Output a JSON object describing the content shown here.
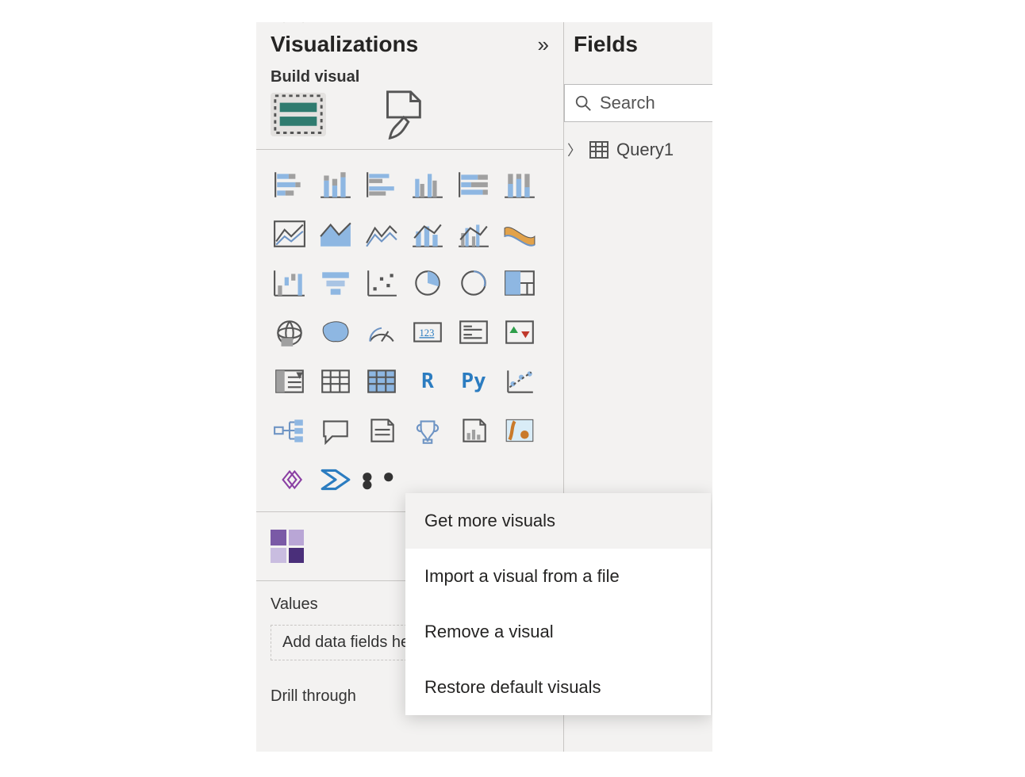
{
  "visualizations": {
    "title": "Visualizations",
    "subhead": "Build visual",
    "tabs": {
      "build": "build-visual",
      "format": "format-page"
    },
    "more_menu": {
      "get_more": "Get more visuals",
      "import_file": "Import a visual from a file",
      "remove": "Remove a visual",
      "restore": "Restore default visuals"
    },
    "values_label": "Values",
    "values_placeholder": "Add data fields here",
    "drillthrough_label": "Drill through",
    "visual_types": [
      "stacked-bar",
      "stacked-column",
      "clustered-bar",
      "clustered-column",
      "100-stacked-bar",
      "100-stacked-column",
      "line",
      "area",
      "stacked-area",
      "line-stacked-column",
      "line-clustered-column",
      "ribbon",
      "waterfall",
      "funnel",
      "scatter",
      "pie",
      "donut",
      "treemap",
      "map",
      "filled-map",
      "gauge",
      "card",
      "multi-row-card",
      "kpi",
      "slicer",
      "table",
      "matrix",
      "r-visual",
      "python-visual",
      "key-influencers",
      "decomposition-tree",
      "qa",
      "smart-narrative",
      "goals",
      "paginated",
      "arcgis",
      "power-apps",
      "power-automate",
      "more"
    ]
  },
  "fields": {
    "title": "Fields",
    "search_placeholder": "Search",
    "tables": [
      {
        "name": "Query1"
      }
    ]
  }
}
